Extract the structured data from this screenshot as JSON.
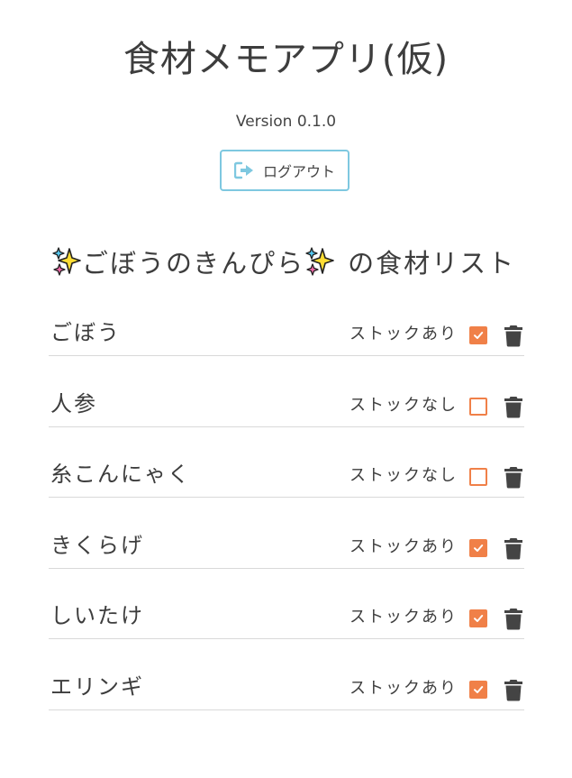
{
  "header": {
    "title": "食材メモアプリ(仮)",
    "version": "Version 0.1.0",
    "logout_label": "ログアウト",
    "logout_icon": "sign-out-icon"
  },
  "list": {
    "heading_dish": "ごぼうのきんぴら",
    "heading_suffix": "の食材リスト",
    "heading_icon": "sparkles-icon"
  },
  "colors": {
    "accent": "#f08048",
    "logout_border": "#7ec8e0",
    "text": "#3d3d3d",
    "trash": "#444444"
  },
  "items": [
    {
      "name": "ごぼう",
      "stock_label": "ストックあり",
      "in_stock": true
    },
    {
      "name": "人参",
      "stock_label": "ストックなし",
      "in_stock": false
    },
    {
      "name": "糸こんにゃく",
      "stock_label": "ストックなし",
      "in_stock": false
    },
    {
      "name": "きくらげ",
      "stock_label": "ストックあり",
      "in_stock": true
    },
    {
      "name": "しいたけ",
      "stock_label": "ストックあり",
      "in_stock": true
    },
    {
      "name": "エリンギ",
      "stock_label": "ストックあり",
      "in_stock": true
    }
  ]
}
